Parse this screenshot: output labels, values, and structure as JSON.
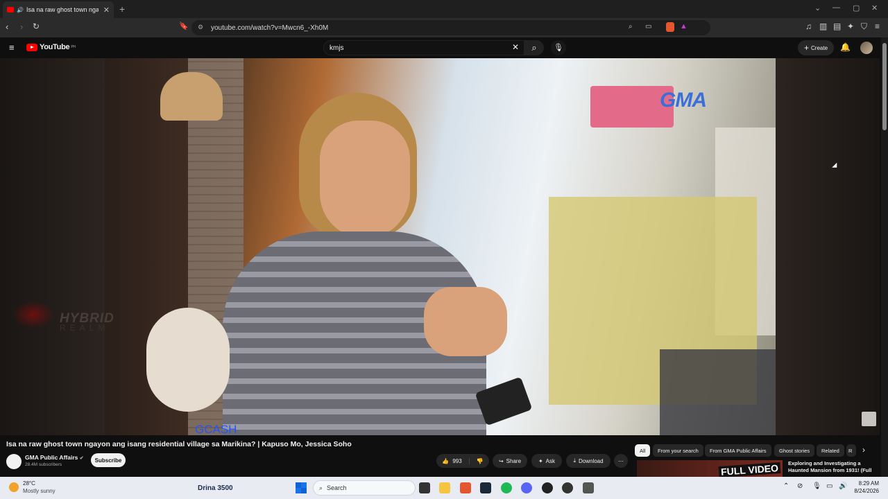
{
  "browser": {
    "tab_title": "Isa na raw ghost town ngayon",
    "tab_close": "✕",
    "new_tab": "+",
    "url": "youtube.com/watch?v=Mwcn6_-Xh0M"
  },
  "youtube": {
    "logo_text": "YouTube",
    "logo_region": "PH",
    "search_value": "kmjs",
    "create_label": "Create"
  },
  "video": {
    "channel_watermark": "GMA",
    "overlay_brand_top": "HYBRID",
    "overlay_brand_bottom": "REALM",
    "sponsor_text": "GCASH",
    "title": "Isa na raw ghost town ngayon ang isang residential village sa Marikina? | Kapuso Mo, Jessica Soho"
  },
  "channel": {
    "name": "GMA Public Affairs",
    "subscribers": "28.4M subscribers",
    "subscribe_label": "Subscribe"
  },
  "actions": {
    "likes": "993",
    "share": "Share",
    "ask": "Ask",
    "download": "Download"
  },
  "chips": [
    "All",
    "From your search",
    "From GMA Public Affairs",
    "Ghost stories",
    "Related",
    "R"
  ],
  "recommendation": {
    "thumb_text": "FULL VIDEO",
    "title": "Exploring and Investigating a Haunted Mansion from 1931! (Full"
  },
  "taskbar": {
    "weather_temp": "28°C",
    "weather_desc": "Mostly sunny",
    "promo": "Drina 3500",
    "search_placeholder": "Search",
    "time": "8:29 AM",
    "date": "8/24/2026"
  },
  "colors": {
    "brand_red": "#ff0000",
    "page_bg": "#0f0f0f",
    "chip_bg": "#272727",
    "chip_active_bg": "#f1f1f1"
  }
}
